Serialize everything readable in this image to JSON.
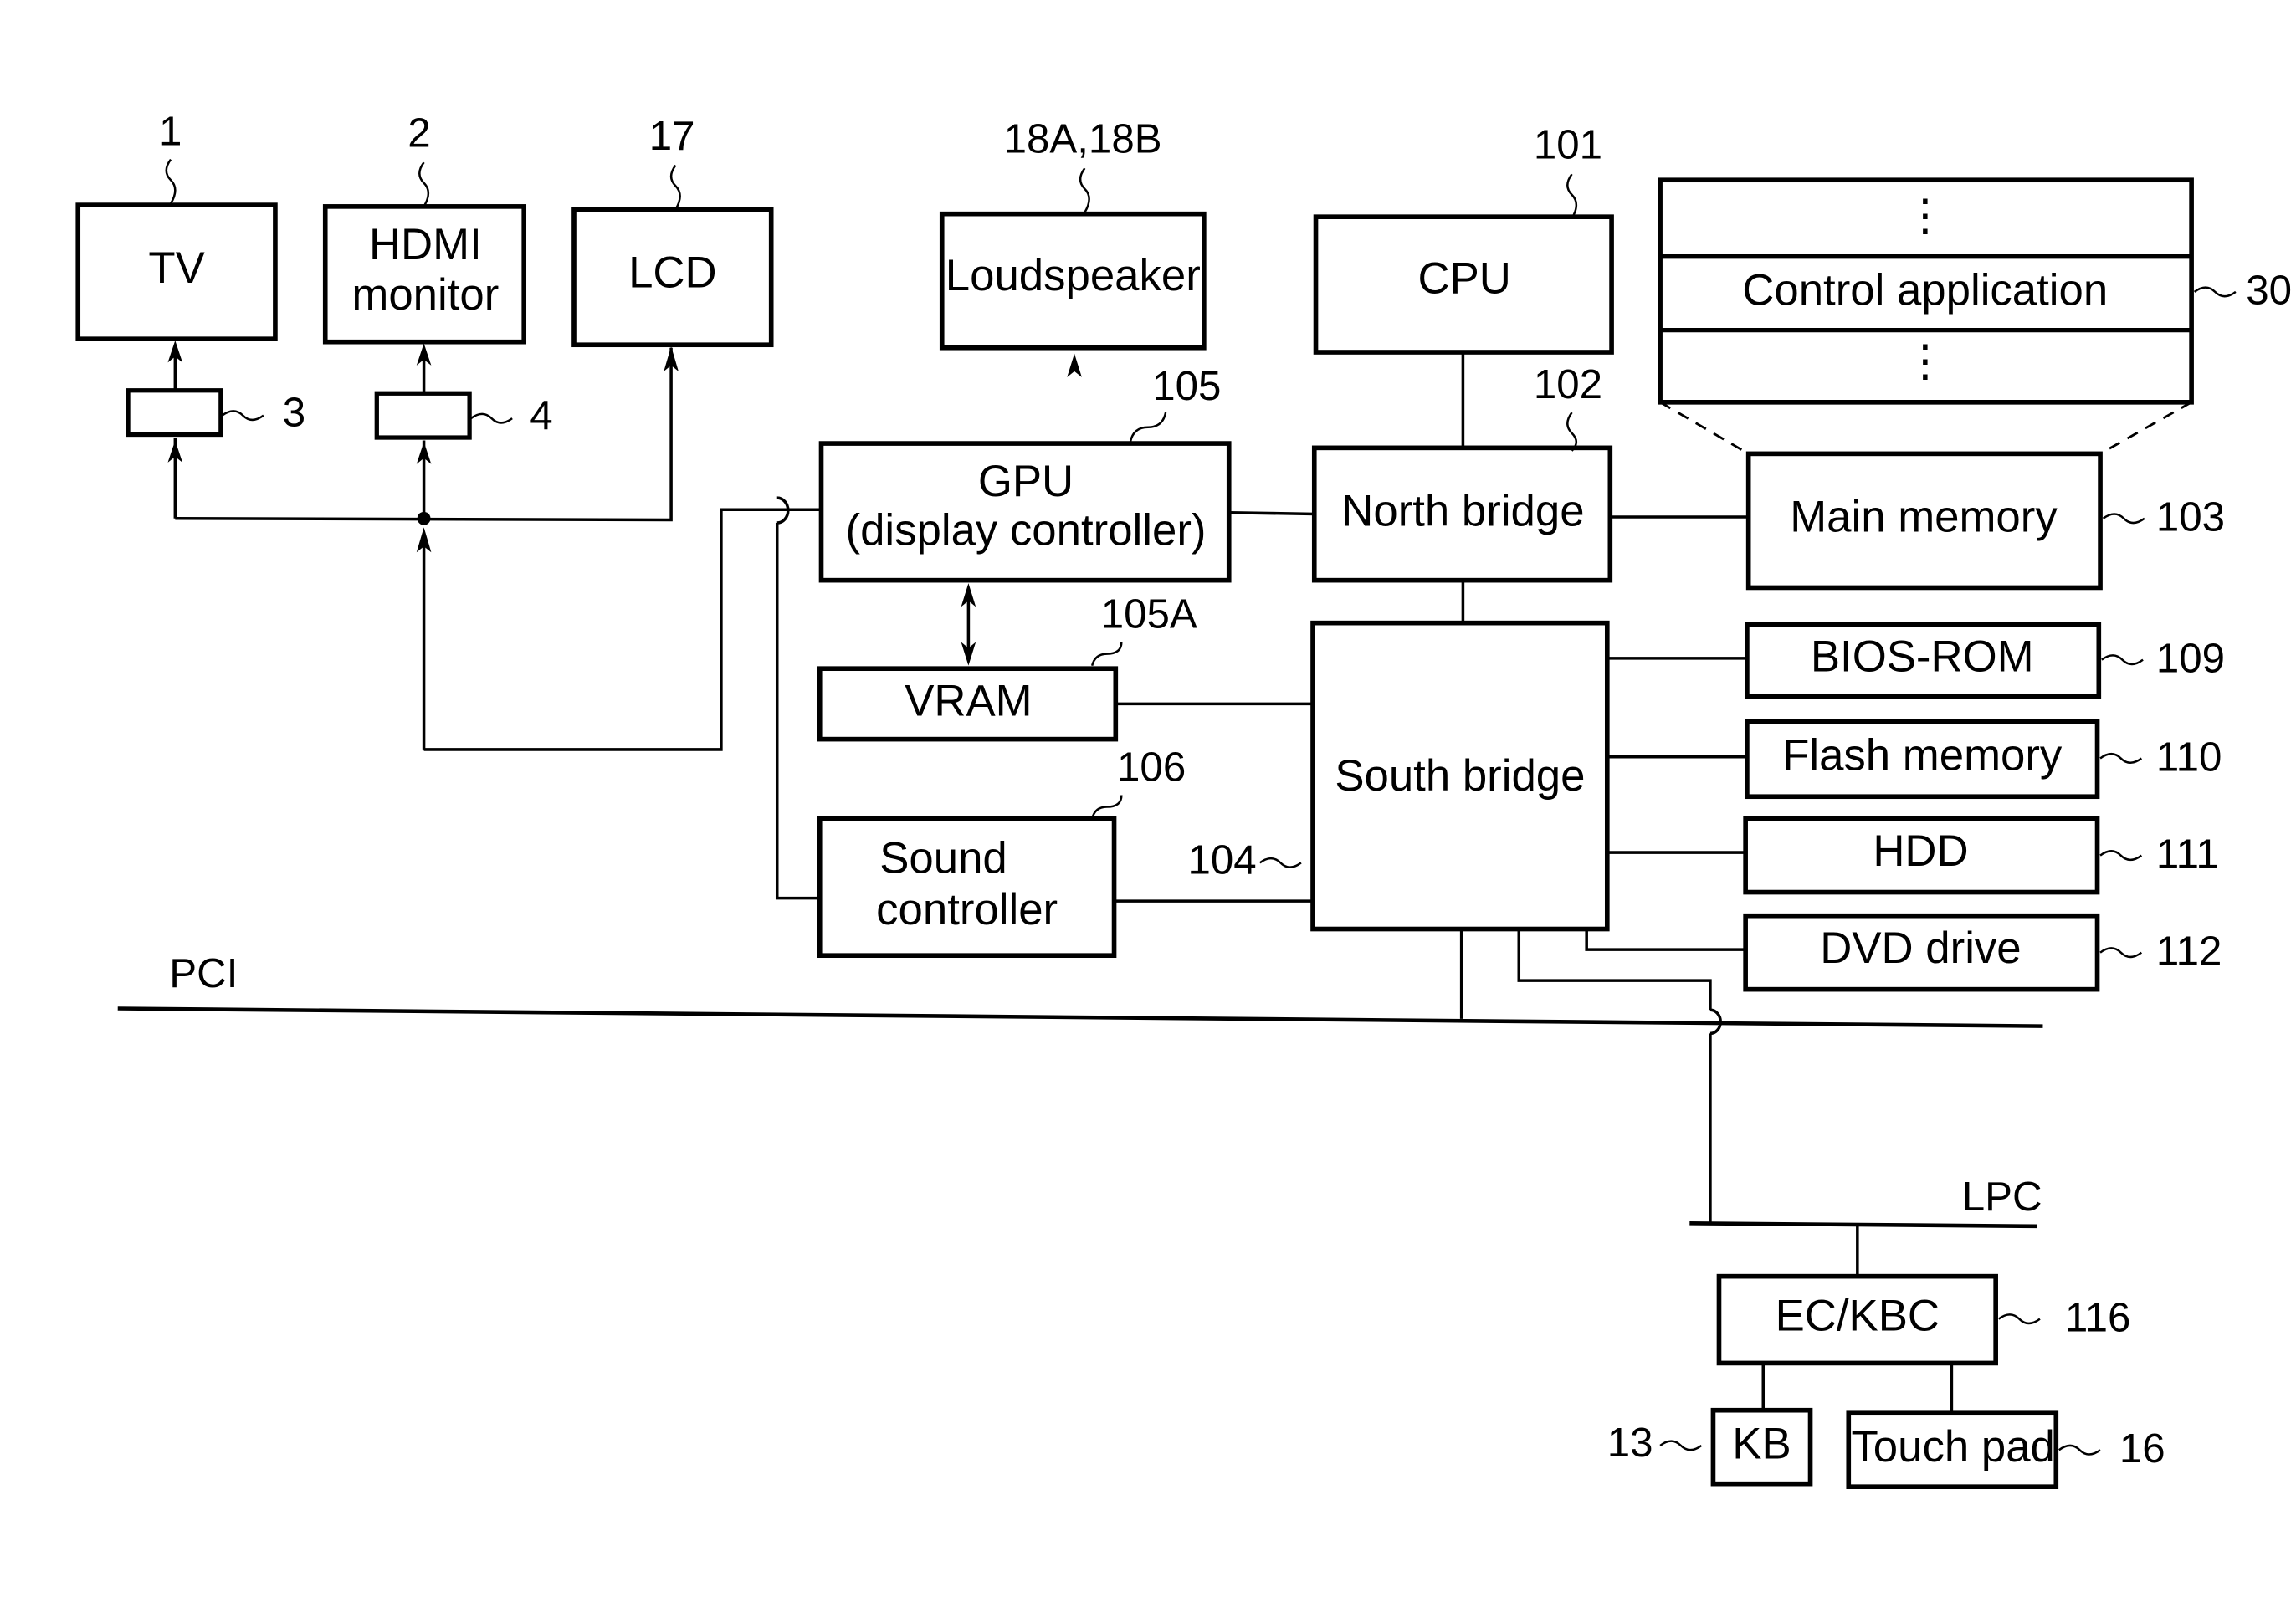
{
  "diagram": {
    "blocks": {
      "tv": {
        "label": "TV",
        "ref": "1"
      },
      "hdmi_monitor": {
        "line1": "HDMI",
        "line2": "monitor",
        "ref": "2"
      },
      "lcd": {
        "label": "LCD",
        "ref": "17"
      },
      "converter_3": {
        "ref": "3"
      },
      "converter_4": {
        "ref": "4"
      },
      "loudspeaker": {
        "label": "Loudspeaker",
        "ref": "18A,18B"
      },
      "cpu": {
        "label": "CPU",
        "ref": "101"
      },
      "control_app": {
        "label": "Control application",
        "ref": "30",
        "ellipsis": "⋮"
      },
      "gpu": {
        "line1": "GPU",
        "line2": "(display controller)",
        "ref": "105"
      },
      "north_bridge": {
        "label": "North bridge",
        "ref": "102"
      },
      "main_memory": {
        "label": "Main memory",
        "ref": "103"
      },
      "vram": {
        "label": "VRAM",
        "ref": "105A"
      },
      "south_bridge": {
        "label": "South bridge",
        "ref": "104"
      },
      "bios_rom": {
        "label": "BIOS-ROM",
        "ref": "109"
      },
      "flash_memory": {
        "label": "Flash memory",
        "ref": "110"
      },
      "hdd": {
        "label": "HDD",
        "ref": "111"
      },
      "dvd_drive": {
        "label": "DVD drive",
        "ref": "112"
      },
      "sound_controller": {
        "line1": "Sound",
        "line2": "controller",
        "ref": "106"
      },
      "ec_kbc": {
        "label": "EC/KBC",
        "ref": "116"
      },
      "kb": {
        "label": "KB",
        "ref": "13"
      },
      "touch_pad": {
        "label": "Touch pad",
        "ref": "16"
      }
    },
    "buses": {
      "pci": "PCI",
      "lpc": "LPC"
    }
  }
}
